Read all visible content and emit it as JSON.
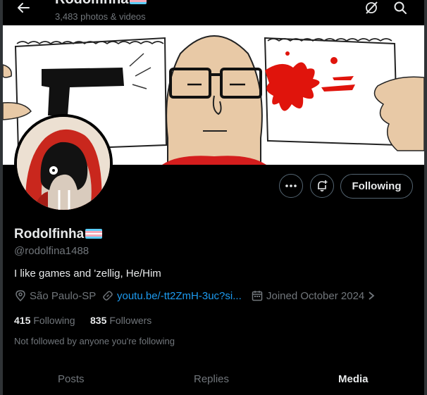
{
  "header": {
    "name": "Rodolfinha",
    "media_count": "3,483 photos & videos"
  },
  "colors": {
    "accent": "#1d9bf0",
    "trans_flag": [
      "#5bcefa",
      "#f5a9b8",
      "#ffffff",
      "#f5a9b8",
      "#5bcefa"
    ]
  },
  "icons": {
    "back": "arrow-left-icon",
    "grok": "grok-icon",
    "search": "search-icon",
    "more": "more-icon",
    "notify": "bell-plus-icon",
    "location": "location-pin-icon",
    "link": "link-icon",
    "calendar": "calendar-icon",
    "chevron": "chevron-right-icon"
  },
  "profile": {
    "display_name": "Rodolfinha",
    "handle": "@rodolfina1488",
    "bio": "I like games and 'zellig, He/Him",
    "location": "São Paulo-SP",
    "website": "youtu.be/-tt2ZmH-3uc?si...",
    "joined": "Joined October 2024",
    "following_count": "415",
    "following_label": "Following",
    "followers_count": "835",
    "followers_label": "Followers",
    "followed_by_note": "Not followed by anyone you're following"
  },
  "actions": {
    "following_button": "Following"
  },
  "tabs": [
    {
      "label": "Posts",
      "active": false
    },
    {
      "label": "Replies",
      "active": false
    },
    {
      "label": "Media",
      "active": true
    }
  ]
}
